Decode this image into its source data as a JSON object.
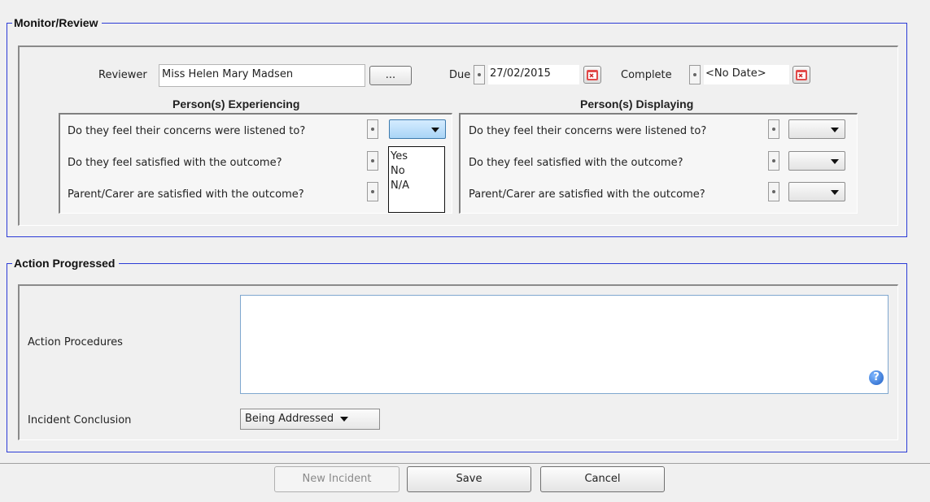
{
  "monitor_review": {
    "title": "Monitor/Review",
    "reviewer_label": "Reviewer",
    "reviewer_value": "Miss Helen Mary Madsen",
    "browse_label": "...",
    "due_label": "Due",
    "due_value": "27/02/2015",
    "complete_label": "Complete",
    "complete_value": "<No Date>",
    "experiencing": {
      "header": "Person(s) Experiencing",
      "questions": [
        "Do they feel their concerns were listened to?",
        "Do they feel satisfied with the outcome?",
        "Parent/Carer are satisfied with the outcome?"
      ],
      "dropdown_options": [
        "Yes",
        "No",
        "N/A"
      ]
    },
    "displaying": {
      "header": "Person(s) Displaying",
      "questions": [
        "Do they feel their concerns were listened to?",
        "Do they feel satisfied with the outcome?",
        "Parent/Carer are satisfied with the outcome?"
      ]
    }
  },
  "action_progressed": {
    "title": "Action Progressed",
    "procedures_label": "Action Procedures",
    "procedures_value": "",
    "conclusion_label": "Incident Conclusion",
    "conclusion_value": "Being Addressed"
  },
  "footer": {
    "new_incident": "New Incident",
    "save": "Save",
    "cancel": "Cancel"
  },
  "icons": {
    "calendar": "calendar-icon",
    "help": "help-icon",
    "dropdown": "chevron-down-icon",
    "null": "null-toggle-icon"
  },
  "colors": {
    "group_border": "#2b3bd6",
    "memo_border": "#7fa7cf"
  }
}
